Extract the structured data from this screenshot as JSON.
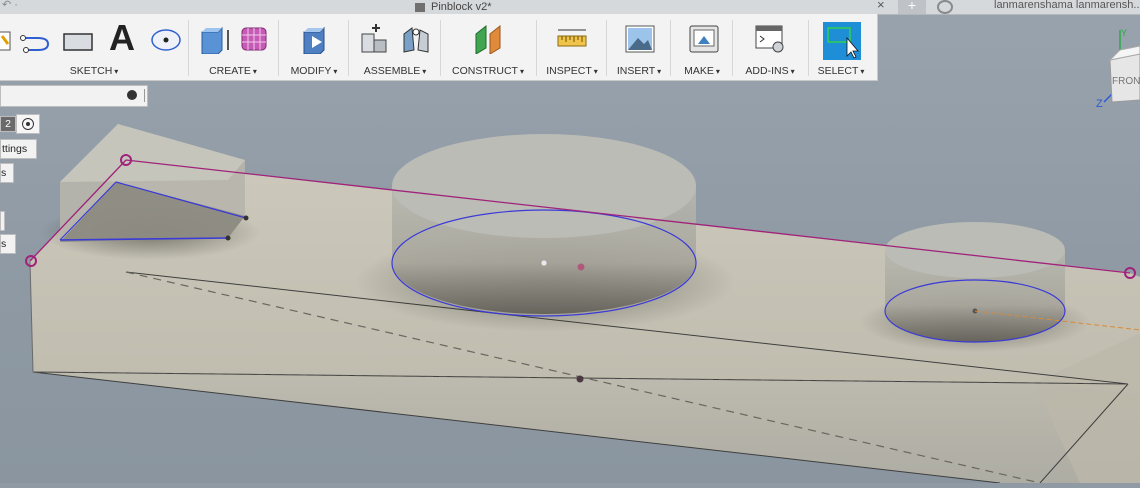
{
  "window": {
    "doc_title": "Pinblock v2*",
    "user_label": "lanmarenshama lanmarensh..."
  },
  "toolbar": {
    "groups": [
      {
        "label": "SKETCH"
      },
      {
        "label": "CREATE"
      },
      {
        "label": "MODIFY"
      },
      {
        "label": "ASSEMBLE"
      },
      {
        "label": "CONSTRUCT"
      },
      {
        "label": "INSPECT"
      },
      {
        "label": "INSERT"
      },
      {
        "label": "MAKE"
      },
      {
        "label": "ADD-INS"
      },
      {
        "label": "SELECT"
      }
    ],
    "dropdown_glyph": "▾",
    "text_tool_glyph": "A"
  },
  "left_panel": {
    "value_box": "2",
    "settings_label": "ttings",
    "row_a": "s",
    "row_b": "s"
  },
  "viewcube": {
    "face_label": "FRONT",
    "axis_z": "Z",
    "axis_y": "Y"
  },
  "colors": {
    "toolbar_bg": "#f3f3f3",
    "select_accent": "#1e8fd6",
    "sketch_line": "#3a3ad8",
    "constraint_line": "#a0227a"
  }
}
